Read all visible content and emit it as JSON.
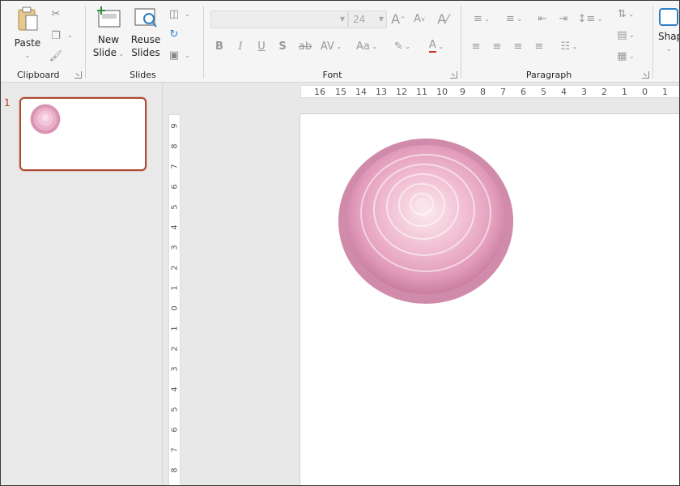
{
  "ribbon": {
    "clipboard": {
      "label": "Clipboard",
      "paste_label": "Paste"
    },
    "slides": {
      "label": "Slides",
      "new_slide_line1": "New",
      "new_slide_line2": "Slide",
      "reuse_line1": "Reuse",
      "reuse_line2": "Slides"
    },
    "font": {
      "label": "Font",
      "font_size": "24",
      "bold": "B",
      "italic": "I",
      "underline": "U",
      "shadow": "S",
      "strike": "ab",
      "spacing": "AV",
      "case": "Aa",
      "grow": "A",
      "shrink": "A"
    },
    "paragraph": {
      "label": "Paragraph"
    },
    "drawing": {
      "shapes_label": "Shap"
    }
  },
  "thumbnails": {
    "slide_number": "1"
  },
  "ruler": {
    "horizontal": [
      "16",
      "15",
      "14",
      "13",
      "12",
      "11",
      "10",
      "9",
      "8",
      "7",
      "6",
      "5",
      "4",
      "3",
      "2",
      "1",
      "0",
      "1"
    ],
    "vertical": [
      "9",
      "8",
      "7",
      "6",
      "5",
      "4",
      "3",
      "2",
      "1",
      "0",
      "1",
      "2",
      "3",
      "4",
      "5",
      "6",
      "7",
      "8"
    ]
  },
  "colors": {
    "accent": "#b04a35",
    "slide_number": "#b23a1f",
    "flower_pink": "#e9a9c3"
  },
  "slide": {
    "image": "pink-camellia-flower"
  }
}
